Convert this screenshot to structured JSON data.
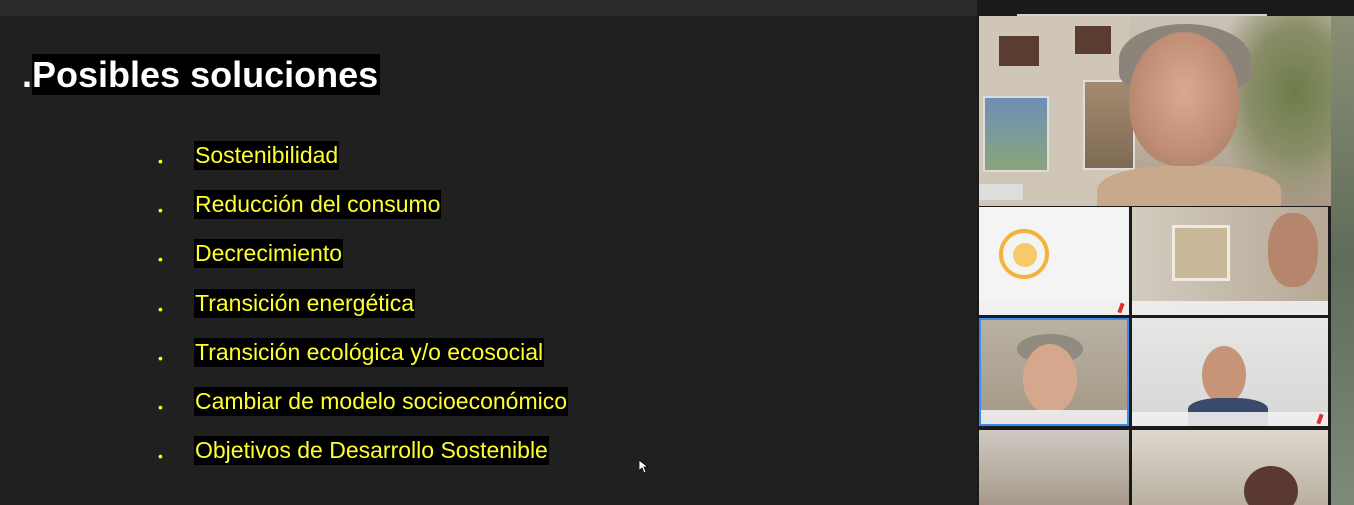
{
  "slide": {
    "title_dot": ".",
    "title": "Posibles soluciones",
    "bullets": [
      "Sostenibilidad",
      "Reducción del consumo",
      "Decrecimiento",
      "Transición energética",
      "Transición ecológica y/o ecosocial",
      "Cambiar de modelo socioeconómico",
      "Objetivos de Desarrollo Sostenible"
    ]
  },
  "colors": {
    "slide_bg": "#202020",
    "title_text": "#ffffff",
    "bullet_text": "#ffff2e",
    "bullet_bg": "#000000",
    "active_speaker_border": "#3b8af0"
  },
  "participants": {
    "active_tile_icon": "speaker-video",
    "muted_icon": "mic-muted-icon"
  }
}
